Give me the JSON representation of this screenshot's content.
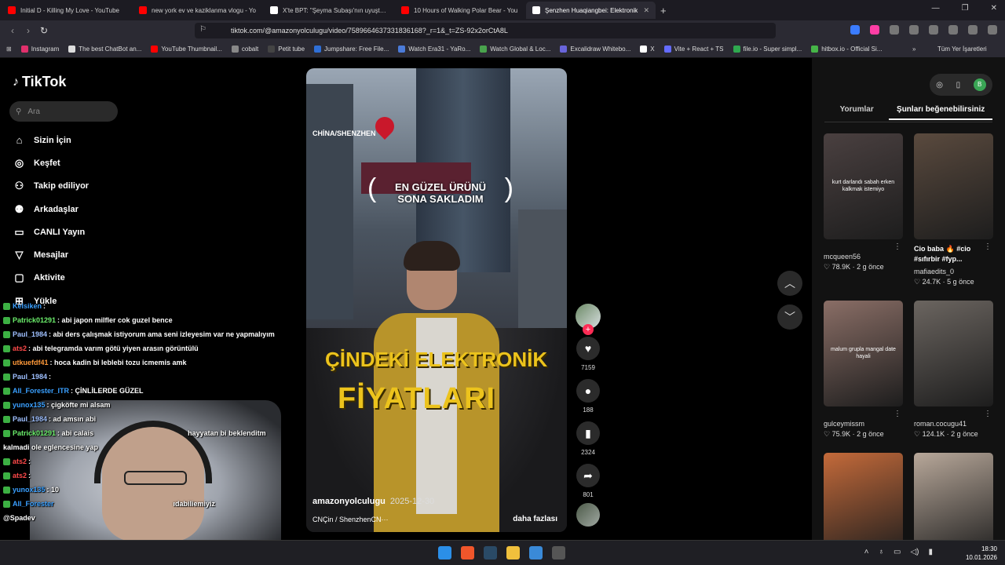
{
  "browser": {
    "tabs": [
      {
        "title": "Initial D - Killing My Love - YouTube",
        "color": "#ff0000"
      },
      {
        "title": "new york ev ve kaziklanma vlogu - Yo",
        "color": "#ff0000"
      },
      {
        "title": "X'te BPT: \"Şeyma Subaşı'nın uyuşturu",
        "color": "#ffffff"
      },
      {
        "title": "10 Hours of Walking Polar Bear - You",
        "color": "#ff0000"
      },
      {
        "title": "Şenzhen Huaqiangbei: Elektronik",
        "color": "#ffffff",
        "active": true
      }
    ],
    "new_tab": "+",
    "url": "tiktok.com/@amazonyolculugu/video/7589664637331836168?_r=1&_t=ZS-92x2orCtA8L",
    "bookmarks": [
      {
        "label": "Instagram",
        "color": "#e1306c"
      },
      {
        "label": "The best ChatBot an...",
        "color": "#dddddd"
      },
      {
        "label": "YouTube Thumbnail...",
        "color": "#ff0000"
      },
      {
        "label": "cobalt",
        "color": "#888888"
      },
      {
        "label": "Petit tube",
        "color": "#444444"
      },
      {
        "label": "Jumpshare: Free File...",
        "color": "#2f6fd6"
      },
      {
        "label": "Watch Era31 - YaRo...",
        "color": "#4b7bd8"
      },
      {
        "label": "Watch Global & Loc...",
        "color": "#49a34d"
      },
      {
        "label": "Excalidraw Whitebo...",
        "color": "#6965db"
      },
      {
        "label": "X",
        "color": "#ffffff"
      },
      {
        "label": "Vite + React + TS",
        "color": "#646cff"
      },
      {
        "label": "file.io - Super simpl...",
        "color": "#2fa84f"
      },
      {
        "label": "hitbox.io - Official Si...",
        "color": "#46b548"
      }
    ],
    "bookmarks_more": "»",
    "all_bookmarks": "Tüm Yer İşaretleri"
  },
  "tiktok": {
    "logo": "TikTok",
    "search_placeholder": "Ara",
    "nav": [
      {
        "label": "Sizin İçin",
        "icon": "home-icon",
        "glyph": "⌂"
      },
      {
        "label": "Keşfet",
        "icon": "compass-icon",
        "glyph": "◎"
      },
      {
        "label": "Takip ediliyor",
        "icon": "person-plus-icon",
        "glyph": "⚇"
      },
      {
        "label": "Arkadaşlar",
        "icon": "people-icon",
        "glyph": "⚉"
      },
      {
        "label": "CANLI Yayın",
        "icon": "live-tv-icon",
        "glyph": "▭"
      },
      {
        "label": "Mesajlar",
        "icon": "send-icon",
        "glyph": "▽"
      },
      {
        "label": "Aktivite",
        "icon": "message-icon",
        "glyph": "▢"
      },
      {
        "label": "Yükle",
        "icon": "upload-icon",
        "glyph": "⊞"
      }
    ],
    "video": {
      "location_tag": "CHİNA/SHENZHEN",
      "badge_line1": "EN GÜZEL ÜRÜNÜ",
      "badge_line2": "SONA SAKLADIM",
      "title_line1": "ÇİNDEKİ ELEKTRONİK",
      "title_line2": "FİYATLARI",
      "author": "amazonyolculugu",
      "date": "2025-12-30",
      "location": "CNÇin / ShenzhenCN···",
      "more": "daha fazlası"
    },
    "actions": {
      "likes": "7159",
      "comments": "188",
      "saves": "2324",
      "shares": "801"
    },
    "right_panel": {
      "tabs": [
        "Yorumlar",
        "Şunları beğenebilirsiniz"
      ],
      "avatar_letter": "B",
      "cards": [
        {
          "overlay": "kurt darlandı sabah erken kalkmak istemiyo",
          "caption": "",
          "user": "mcqueen56",
          "stats": "♡ 78.9K · 2 g önce",
          "bg": "#4a4040"
        },
        {
          "overlay": "",
          "caption": "Cio baba 🔥 #cio #sıfırbir #fyp...",
          "user": "mafiaedits_0",
          "stats": "♡ 24.7K · 5 g önce",
          "bg": "#5a4a3e"
        },
        {
          "overlay": "malum grupla mangal date hayali",
          "caption": "",
          "user": "gulceymissm",
          "stats": "♡ 75.9K · 2 g önce",
          "bg": "#8a6e66"
        },
        {
          "overlay": "",
          "caption": "",
          "user": "roman.cocugu41",
          "stats": "♡ 124.1K · 2 g önce",
          "bg": "#6b6560"
        },
        {
          "overlay": "",
          "caption": "",
          "user": "",
          "stats": "",
          "bg": "#c46a3a"
        },
        {
          "overlay": "",
          "caption": "",
          "user": "",
          "stats": "",
          "bg": "#b8a89a"
        }
      ]
    }
  },
  "chat": [
    {
      "user": "Kelsiken",
      "msg": ":",
      "color": "#3aa0ff"
    },
    {
      "user": "Patrick01291",
      "msg": ": abi japon milfler cok guzel bence",
      "color": "#6cf06c"
    },
    {
      "user": "Paul_1984",
      "msg": ": abi ders çalışmak istiyorum ama seni izleyesim var ne yapmalıyım",
      "color": "#9fc0ff"
    },
    {
      "user": "ats2",
      "msg": ": abi telegramda varım götü yiyen arasın görüntülü",
      "color": "#ff4a4a"
    },
    {
      "user": "utkuefdf41",
      "msg": ": hoca kadin bi leblebi tozu icmemis amk",
      "color": "#ff9a3a"
    },
    {
      "user": "Paul_1984",
      "msg": ":",
      "color": "#9fc0ff"
    },
    {
      "user": "All_Forester_ITR",
      "msg": ": ÇİNLİLERDE GÜZEL",
      "color": "#3aa0ff"
    },
    {
      "user": "yunox135",
      "msg": ": çigköfte mi alsam",
      "color": "#3aa0ff"
    },
    {
      "user": "Paul_1984",
      "msg": ": ad amsın abi",
      "color": "#9fc0ff"
    },
    {
      "user": "Patrick01291",
      "msg": ": abi calais",
      "color": "#6cf06c"
    },
    {
      "user": "ats2",
      "msg": ":",
      "color": "#ff4a4a"
    },
    {
      "user": "ats2",
      "msg": ":",
      "color": "#ff4a4a"
    },
    {
      "user": "yunox135",
      "msg": ": 10",
      "color": "#3aa0ff"
    },
    {
      "user": "All_Forester",
      "msg": "",
      "color": "#3aa0ff"
    }
  ],
  "chat_fragments": {
    "line10_tail": "hayyatan bi beklenditm",
    "line11": "kalmadi ole eglencesine yap",
    "line14_tail": "ıdabiliemiyiz",
    "line15": "@Spadev"
  },
  "taskbar": {
    "time": "18:30",
    "date": "10.01.2026"
  }
}
